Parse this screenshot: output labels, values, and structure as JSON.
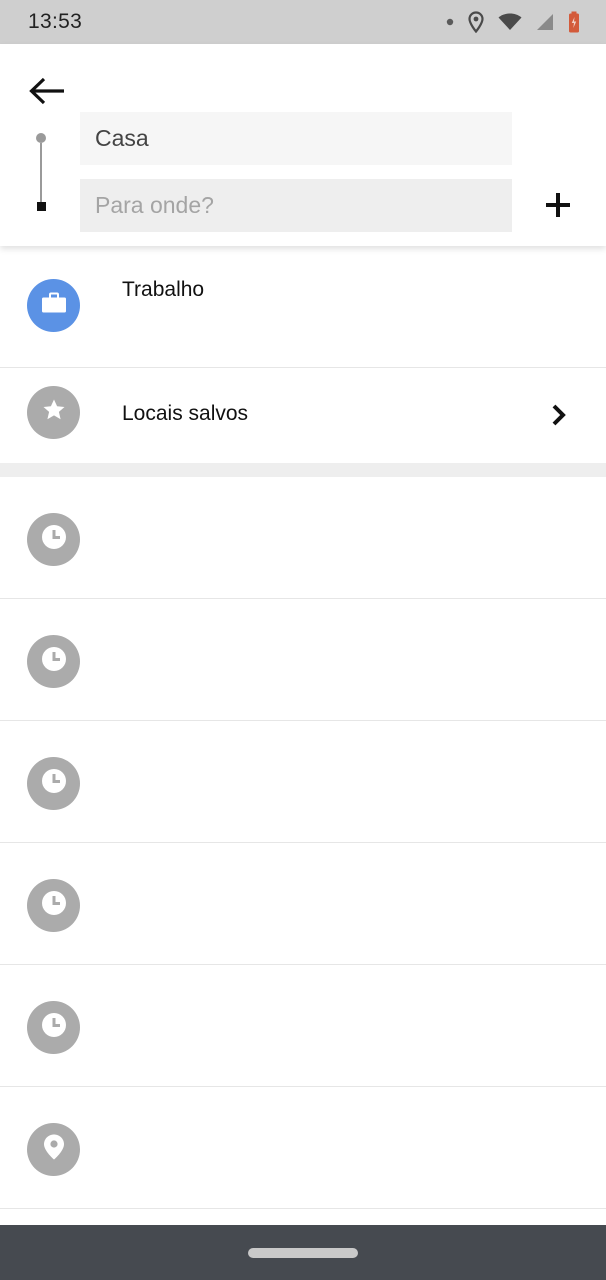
{
  "status_bar": {
    "time": "13:53",
    "icons": [
      "notification-dot-icon",
      "location-icon",
      "wifi-icon",
      "cell-signal-icon",
      "battery-icon"
    ]
  },
  "search": {
    "origin_value": "Casa",
    "destination_placeholder": "Para onde?",
    "destination_value": ""
  },
  "saved": {
    "work_label": "Trabalho",
    "saved_places_label": "Locais salvos"
  },
  "history": [
    {
      "icon": "clock-icon",
      "label": ""
    },
    {
      "icon": "clock-icon",
      "label": ""
    },
    {
      "icon": "clock-icon",
      "label": ""
    },
    {
      "icon": "clock-icon",
      "label": ""
    },
    {
      "icon": "clock-icon",
      "label": ""
    },
    {
      "icon": "pin-icon",
      "label": ""
    }
  ],
  "colors": {
    "work_circle": "#5b92e5",
    "gray_circle": "#ababab",
    "status_bar": "#cfcfcf",
    "nav_bar": "#464a50",
    "battery": "#d35b3b"
  }
}
